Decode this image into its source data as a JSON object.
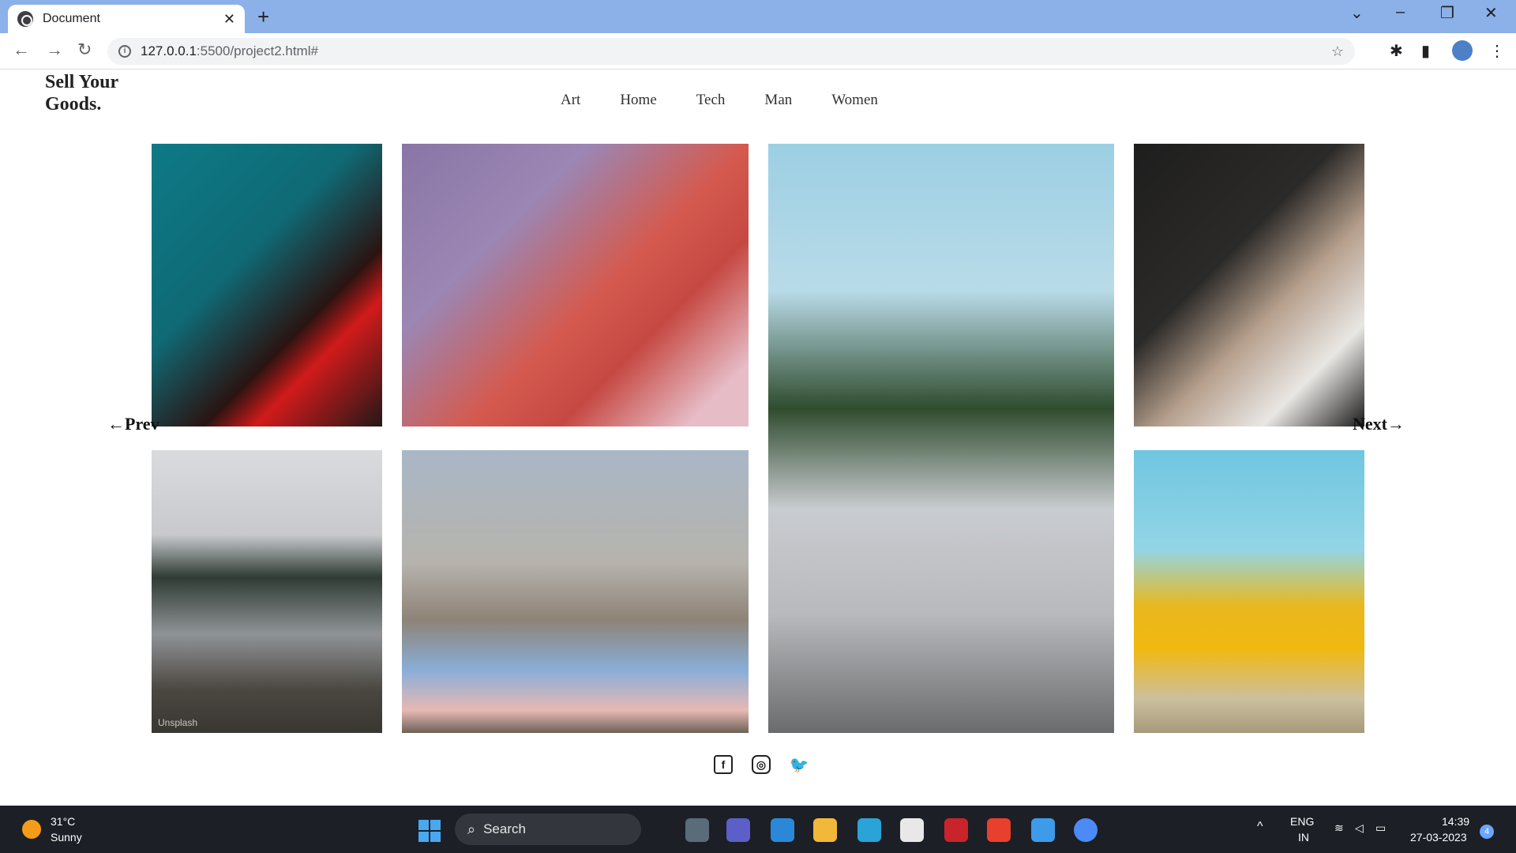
{
  "browser": {
    "tab_title": "Document",
    "tab_close": "✕",
    "new_tab": "+",
    "url_host": "127.0.0.1",
    "url_rest": ":5500/project2.html#"
  },
  "site": {
    "brand": "Sell Your Goods.",
    "nav": [
      "Art",
      "Home",
      "Tech",
      "Man",
      "Women"
    ],
    "prev_label": "Prev",
    "next_label": "Next"
  },
  "gallery": [
    {
      "name": "blonde woman with sunglasses in red top"
    },
    {
      "name": "woman with pink hair and hoop earrings"
    },
    {
      "name": "woman in grey dress with wide hat"
    },
    {
      "name": "woman with hat in white blouse"
    },
    {
      "name": "woman sitting by frozen lake",
      "watermark": "Unsplash"
    },
    {
      "name": "woman in blue coat with birds at cathedral"
    },
    {
      "name": "woman in yellow tracksuit at basketball court"
    }
  ],
  "social": [
    "facebook-icon",
    "instagram-icon",
    "twitter-icon"
  ],
  "taskbar": {
    "temperature": "31°C",
    "condition": "Sunny",
    "search_label": "Search",
    "lang_line1": "ENG",
    "lang_line2": "IN",
    "time": "14:39",
    "date": "27-03-2023",
    "notification_count": "4"
  },
  "colors": {
    "tabbar": "#8cb0e8",
    "taskbar": "#1c1f26"
  }
}
